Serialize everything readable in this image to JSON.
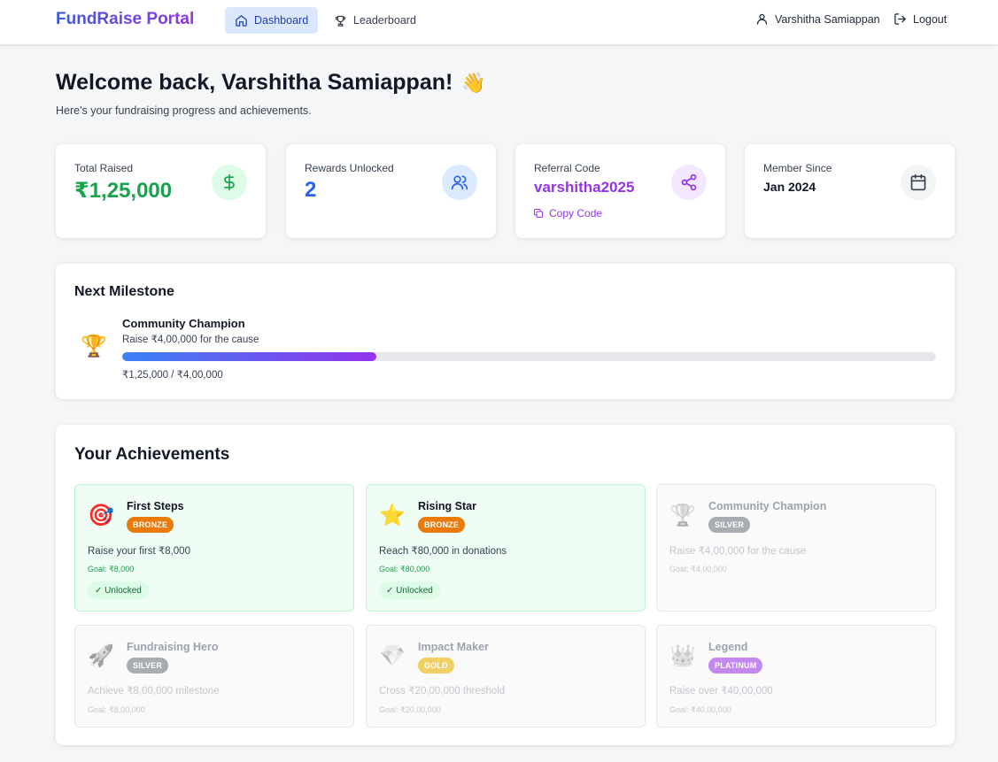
{
  "nav": {
    "brand": "FundRaise Portal",
    "links": [
      {
        "label": "Dashboard",
        "icon": "home-icon",
        "active": true
      },
      {
        "label": "Leaderboard",
        "icon": "trophy-icon",
        "active": false
      }
    ],
    "user_name": "Varshitha Samiappan",
    "logout_label": "Logout"
  },
  "welcome": {
    "title": "Welcome back, Varshitha Samiappan!",
    "emoji": "👋",
    "subtitle": "Here's your fundraising progress and achievements."
  },
  "stats": {
    "total_raised": {
      "label": "Total Raised",
      "value": "₹1,25,000",
      "icon": "dollar-icon",
      "color": "#16a34a"
    },
    "rewards": {
      "label": "Rewards Unlocked",
      "value": "2",
      "icon": "users-icon",
      "color": "#2563eb"
    },
    "referral": {
      "label": "Referral Code",
      "value": "varshitha2025",
      "copy_label": "Copy Code",
      "icon": "share-icon",
      "color": "#9333ea"
    },
    "member": {
      "label": "Member Since",
      "value": "Jan 2024",
      "icon": "calendar-icon",
      "color": "#111827"
    }
  },
  "milestone": {
    "section_title": "Next Milestone",
    "icon": "🏆",
    "name": "Community Champion",
    "description": "Raise ₹4,00,000 for the cause",
    "current": 125000,
    "target": 400000,
    "progress_text": "₹1,25,000 / ₹4,00,000"
  },
  "achievements": {
    "section_title": "Your Achievements",
    "items": [
      {
        "icon": "🎯",
        "name": "First Steps",
        "tier": "BRONZE",
        "tier_class": "bronze",
        "description": "Raise your first ₹8,000",
        "goal": "Goal: ₹8,000",
        "unlocked": true,
        "status": "✓ Unlocked"
      },
      {
        "icon": "⭐",
        "name": "Rising Star",
        "tier": "BRONZE",
        "tier_class": "bronze",
        "description": "Reach ₹80,000 in donations",
        "goal": "Goal: ₹80,000",
        "unlocked": true,
        "status": "✓ Unlocked"
      },
      {
        "icon": "🏆",
        "name": "Community Champion",
        "tier": "SILVER",
        "tier_class": "silver",
        "description": "Raise ₹4,00,000 for the cause",
        "goal": "Goal: ₹4,00,000",
        "unlocked": false,
        "status": ""
      },
      {
        "icon": "🚀",
        "name": "Fundraising Hero",
        "tier": "SILVER",
        "tier_class": "silver",
        "description": "Achieve ₹8,00,000 milestone",
        "goal": "Goal: ₹8,00,000",
        "unlocked": false,
        "status": ""
      },
      {
        "icon": "💎",
        "name": "Impact Maker",
        "tier": "GOLD",
        "tier_class": "gold",
        "description": "Cross ₹20,00,000 threshold",
        "goal": "Goal: ₹20,00,000",
        "unlocked": false,
        "status": ""
      },
      {
        "icon": "👑",
        "name": "Legend",
        "tier": "PLATINUM",
        "tier_class": "platinum",
        "description": "Raise over ₹40,00,000",
        "goal": "Goal: ₹40,00,000",
        "unlocked": false,
        "status": ""
      }
    ]
  }
}
